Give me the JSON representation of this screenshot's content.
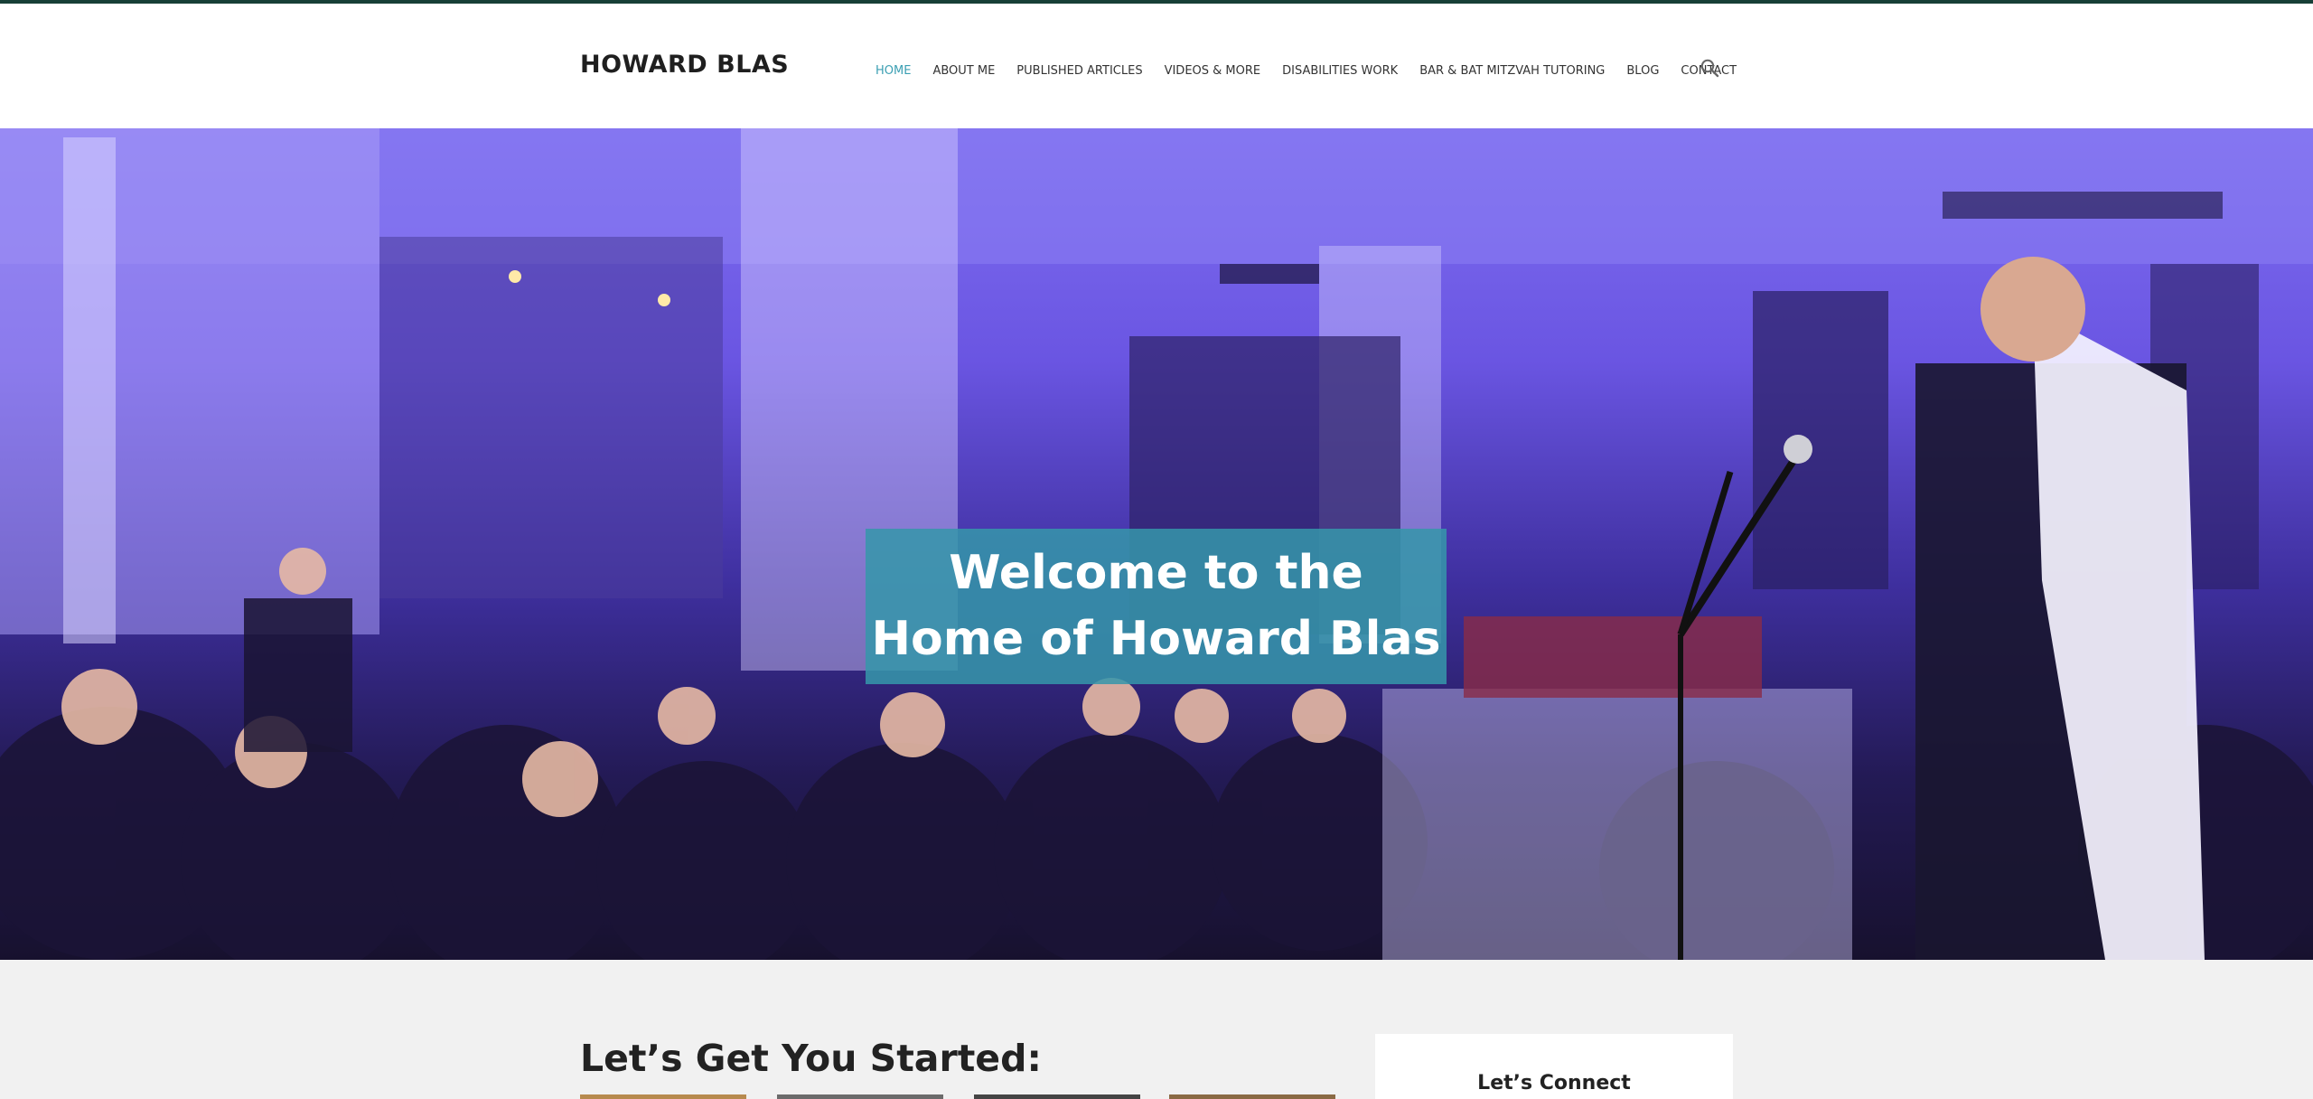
{
  "site": {
    "logo": "HOWARD BLAS"
  },
  "nav": {
    "items": [
      {
        "label": "HOME",
        "active": true
      },
      {
        "label": "ABOUT ME",
        "active": false
      },
      {
        "label": "PUBLISHED ARTICLES",
        "active": false
      },
      {
        "label": "VIDEOS & MORE",
        "active": false
      },
      {
        "label": "DISABILITIES WORK",
        "active": false
      },
      {
        "label": "BAR & BAT MITZVAH TUTORING",
        "active": false
      },
      {
        "label": "BLOG",
        "active": false
      },
      {
        "label": "CONTACT",
        "active": false
      }
    ],
    "search_icon": "search-icon"
  },
  "hero": {
    "line1": "Welcome to the",
    "line2": "Home of Howard Blas"
  },
  "content": {
    "heading": "Let’s Get You Started:"
  },
  "sidebar": {
    "connect_title": "Let’s Connect"
  },
  "colors": {
    "top_strip": "#173f37",
    "nav_active": "#3b9fb3",
    "welcome_box": "#3696aa",
    "page_bg": "#f1f1f1"
  }
}
